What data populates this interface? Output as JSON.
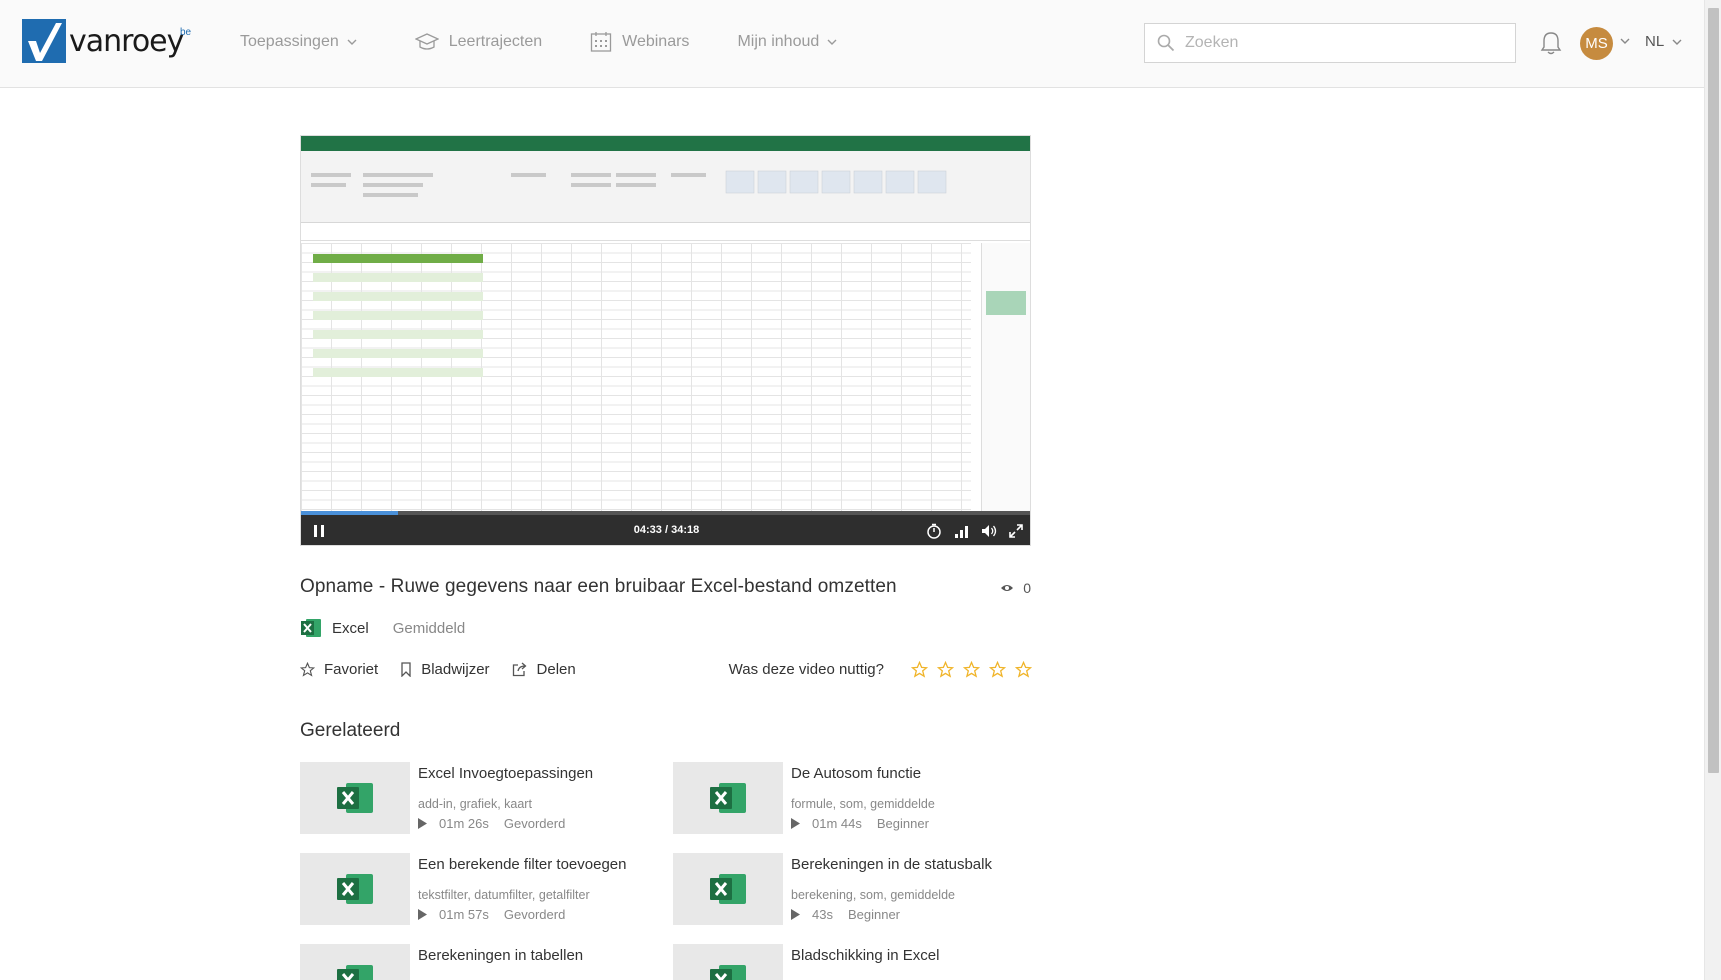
{
  "header": {
    "logo_text": "vanroey",
    "logo_sup": "be",
    "nav": [
      {
        "label": "Toepassingen",
        "icon": "chevron-down-icon"
      },
      {
        "label": "Leertrajecten",
        "icon": "graduation-cap-icon"
      },
      {
        "label": "Webinars",
        "icon": "calendar-icon"
      },
      {
        "label": "Mijn inhoud",
        "icon": "chevron-down-icon"
      }
    ],
    "search_placeholder": "Zoeken",
    "avatar_initials": "MS",
    "language": "NL"
  },
  "player": {
    "time": "04:33 / 34:18",
    "progress_fraction": 0.133
  },
  "video": {
    "title": "Opname - Ruwe gegevens naar een bruibaar Excel-bestand omzetten",
    "views": "0",
    "app": "Excel",
    "level": "Gemiddeld"
  },
  "actions": {
    "favorite": "Favoriet",
    "bookmark": "Bladwijzer",
    "share": "Delen",
    "rating_question": "Was deze video nuttig?"
  },
  "related": {
    "heading": "Gerelateerd",
    "items": [
      {
        "title": "Excel Invoegtoepassingen",
        "tags": "add-in, grafiek, kaart",
        "duration": "01m 26s",
        "level": "Gevorderd"
      },
      {
        "title": "De Autosom functie",
        "tags": "formule, som, gemiddelde",
        "duration": "01m 44s",
        "level": "Beginner"
      },
      {
        "title": "Een berekende filter toevoegen",
        "tags": "tekstfilter, datumfilter, getalfilter",
        "duration": "01m 57s",
        "level": "Gevorderd"
      },
      {
        "title": "Berekeningen in de statusbalk",
        "tags": "berekening, som, gemiddelde",
        "duration": "43s",
        "level": "Beginner"
      },
      {
        "title": "Berekeningen in tabellen",
        "tags": "",
        "duration": "",
        "level": ""
      },
      {
        "title": "Bladschikking in Excel",
        "tags": "",
        "duration": "",
        "level": ""
      }
    ]
  },
  "colors": {
    "excel_green": "#217346",
    "star": "#f0b429",
    "avatar": "#c68b3f",
    "brand_blue": "#1f6cb0"
  }
}
